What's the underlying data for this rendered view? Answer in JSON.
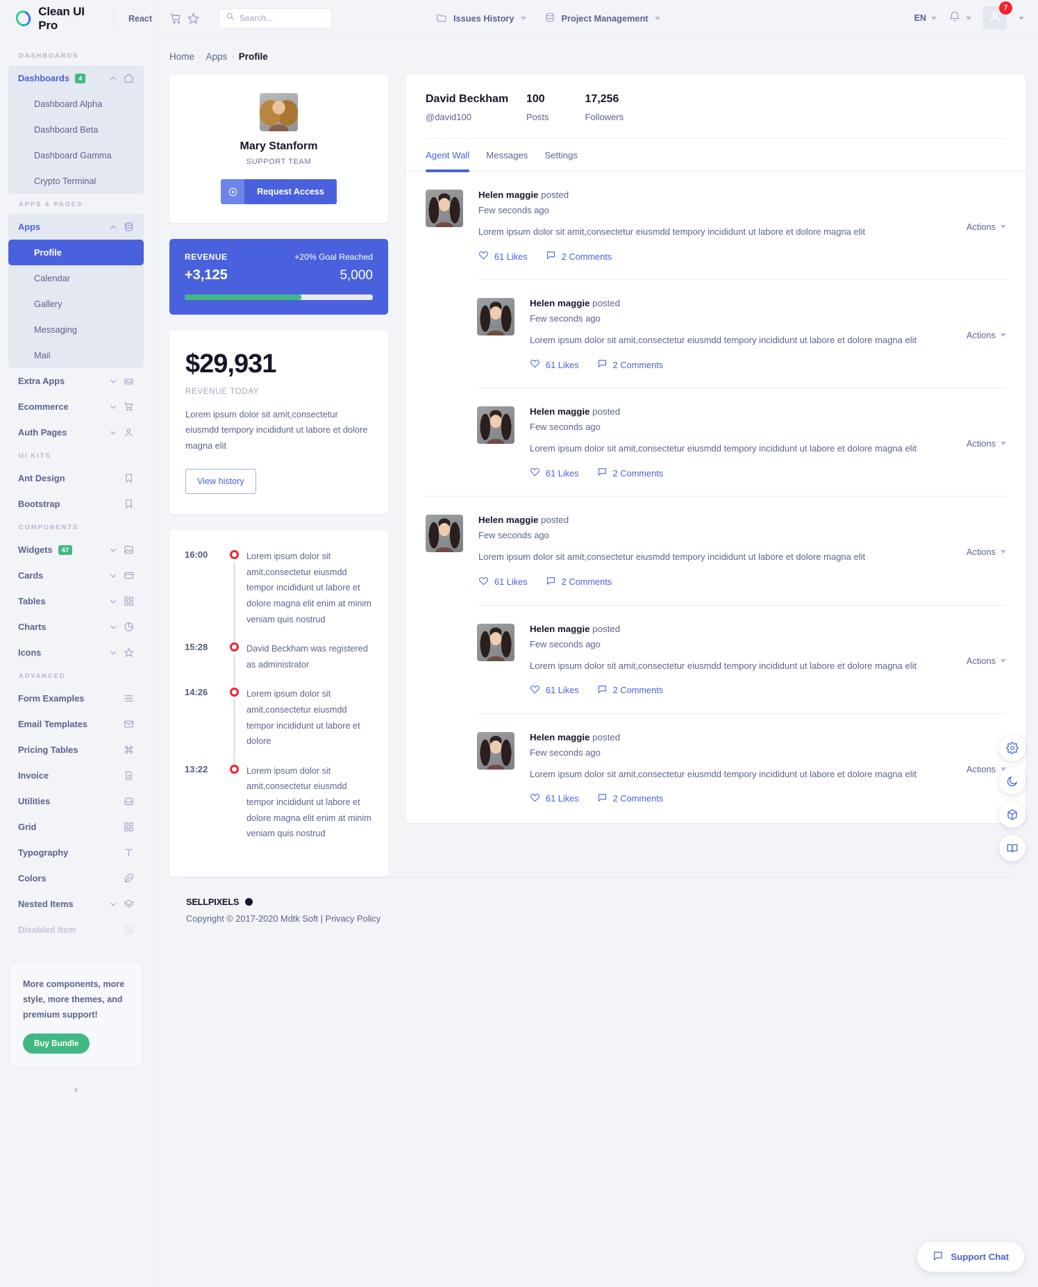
{
  "brand": {
    "name": "Clean UI Pro",
    "framework": "React",
    "logo_icon": "circle-logo-icon"
  },
  "topbar": {
    "cart_icon": "cart-icon",
    "star_icon": "star-icon",
    "search": {
      "placeholder": "Search...",
      "value": "",
      "icon": "search-icon"
    },
    "nav": [
      {
        "label": "Issues History",
        "icon": "folder-icon"
      },
      {
        "label": "Project Management",
        "icon": "database-icon"
      }
    ],
    "language": "EN",
    "bell_icon": "bell-icon",
    "avatar_icon": "user-avatar-icon",
    "avatar_badge": "7"
  },
  "sidebar": {
    "sections": [
      {
        "title": "DASHBOARDS",
        "groups": [
          {
            "label": "Dashboards",
            "badge": "4",
            "icon": "home-icon",
            "open": true,
            "children": [
              "Dashboard Alpha",
              "Dashboard Beta",
              "Dashboard Gamma",
              "Crypto Terminal"
            ]
          }
        ]
      },
      {
        "title": "APPS & PAGES",
        "groups": [
          {
            "label": "Apps",
            "icon": "database-icon",
            "open": true,
            "children": [
              "Profile",
              "Calendar",
              "Gallery",
              "Messaging",
              "Mail"
            ],
            "active_child": "Profile"
          },
          {
            "label": "Extra Apps",
            "icon": "inbox-icon",
            "open": false
          },
          {
            "label": "Ecommerce",
            "icon": "cart-icon",
            "open": false
          },
          {
            "label": "Auth Pages",
            "icon": "user-icon",
            "open": false
          }
        ]
      },
      {
        "title": "UI KITS",
        "groups": [
          {
            "label": "Ant Design",
            "icon": "bookmark-icon"
          },
          {
            "label": "Bootstrap",
            "icon": "bookmark-icon"
          }
        ]
      },
      {
        "title": "COMPONENTS",
        "groups": [
          {
            "label": "Widgets",
            "badge": "47",
            "icon": "image-icon",
            "open": false
          },
          {
            "label": "Cards",
            "icon": "card-icon",
            "open": false
          },
          {
            "label": "Tables",
            "icon": "grid-icon",
            "open": false
          },
          {
            "label": "Charts",
            "icon": "pie-chart-icon",
            "open": false
          },
          {
            "label": "Icons",
            "icon": "star-icon",
            "open": false
          }
        ]
      },
      {
        "title": "ADVANCED",
        "groups": [
          {
            "label": "Form Examples",
            "icon": "menu-icon"
          },
          {
            "label": "Email Templates",
            "icon": "mail-icon"
          },
          {
            "label": "Pricing Tables",
            "icon": "command-icon"
          },
          {
            "label": "Invoice",
            "icon": "file-icon"
          },
          {
            "label": "Utilities",
            "icon": "inbox-tray-icon"
          },
          {
            "label": "Grid",
            "icon": "grid-icon"
          },
          {
            "label": "Typography",
            "icon": "type-icon"
          },
          {
            "label": "Colors",
            "icon": "feather-icon"
          },
          {
            "label": "Nested Items",
            "icon": "layers-icon",
            "open": false
          },
          {
            "label": "Disabled Item",
            "icon": "ban-icon",
            "disabled": true
          }
        ]
      }
    ],
    "promo": {
      "text": "More components, more style, more themes, and premium support!",
      "button": "Buy Bundle"
    },
    "collapse_icon": "chevron-left-icon"
  },
  "breadcrumb": {
    "items": [
      "Home",
      "Apps"
    ],
    "current": "Profile",
    "separator": "·"
  },
  "profile_card": {
    "avatar": "mary-avatar",
    "name": "Mary Stanform",
    "role": "SUPPORT TEAM",
    "button": "Request Access",
    "button_icon": "plus-circle-icon"
  },
  "revenue_banner": {
    "label": "REVENUE",
    "goal": "+20% Goal Reached",
    "amount": "+3,125",
    "target": "5,000",
    "progress_percent": 62,
    "bg_color": "#4a61dd",
    "bar_color": "#41b883"
  },
  "revenue_today": {
    "amount": "$29,931",
    "label": "REVENUE TODAY",
    "description": "Lorem ipsum dolor sit amit,consectetur eiusmdd tempory incididunt ut labore et dolore magna elit",
    "button": "View history"
  },
  "timeline": [
    {
      "time": "16:00",
      "text": "Lorem ipsum dolor sit amit,consectetur eiusmdd tempor incididunt ut labore et dolore magna elit enim at minim veniam quis nostrud"
    },
    {
      "time": "15:28",
      "text": "David Beckham was registered as administrator"
    },
    {
      "time": "14:26",
      "text": "Lorem ipsum dolor sit amit,consectetur eiusmdd tempor incididunt ut labore et dolore"
    },
    {
      "time": "13:22",
      "text": "Lorem ipsum dolor sit amit,consectetur eiusmdd tempor incididunt ut labore et dolore magna elit enim at minim veniam quis nostrud"
    }
  ],
  "wall": {
    "user": {
      "name": "David Beckham",
      "handle": "@david100"
    },
    "stats": [
      {
        "value": "100",
        "label": "Posts"
      },
      {
        "value": "17,256",
        "label": "Followers"
      }
    ],
    "tabs": [
      {
        "label": "Agent Wall",
        "active": true
      },
      {
        "label": "Messages",
        "active": false
      },
      {
        "label": "Settings",
        "active": false
      }
    ],
    "actions_label": "Actions",
    "likes_icon": "heart-icon",
    "comments_icon": "comment-icon",
    "posts": [
      {
        "author": "Helen maggie",
        "verb": "posted",
        "time": "Few seconds ago",
        "text": "Lorem ipsum dolor sit amit,consectetur eiusmdd tempory incididunt ut labore et dolore magna elit",
        "likes": "61 Likes",
        "comments": "2 Comments",
        "indent": false
      },
      {
        "author": "Helen maggie",
        "verb": "posted",
        "time": "Few seconds ago",
        "text": "Lorem ipsum dolor sit amit,consectetur eiusmdd tempory incididunt ut labore et dolore magna elit",
        "likes": "61 Likes",
        "comments": "2 Comments",
        "indent": true
      },
      {
        "author": "Helen maggie",
        "verb": "posted",
        "time": "Few seconds ago",
        "text": "Lorem ipsum dolor sit amit,consectetur eiusmdd tempory incididunt ut labore et dolore magna elit",
        "likes": "61 Likes",
        "comments": "2 Comments",
        "indent": true
      },
      {
        "author": "Helen maggie",
        "verb": "posted",
        "time": "Few seconds ago",
        "text": "Lorem ipsum dolor sit amit,consectetur eiusmdd tempory incididunt ut labore et dolore magna elit",
        "likes": "61 Likes",
        "comments": "2 Comments",
        "indent": false
      },
      {
        "author": "Helen maggie",
        "verb": "posted",
        "time": "Few seconds ago",
        "text": "Lorem ipsum dolor sit amit,consectetur eiusmdd tempory incididunt ut labore et dolore magna elit",
        "likes": "61 Likes",
        "comments": "2 Comments",
        "indent": true
      },
      {
        "author": "Helen maggie",
        "verb": "posted",
        "time": "Few seconds ago",
        "text": "Lorem ipsum dolor sit amit,consectetur eiusmdd tempory incididunt ut labore et dolore magna elit",
        "likes": "61 Likes",
        "comments": "2 Comments",
        "indent": true
      }
    ]
  },
  "fabs": [
    {
      "icon": "gear-icon"
    },
    {
      "icon": "moon-icon"
    },
    {
      "icon": "cube-icon"
    },
    {
      "icon": "book-icon"
    }
  ],
  "footer": {
    "logo_text": "SELLPIXELS",
    "logo_dot": "black-dot-icon",
    "copyright": "Copyright © 2017-2020 Mdtk Soft | Privacy Policy"
  },
  "support_chat": {
    "label": "Support Chat",
    "icon": "comment-icon"
  }
}
